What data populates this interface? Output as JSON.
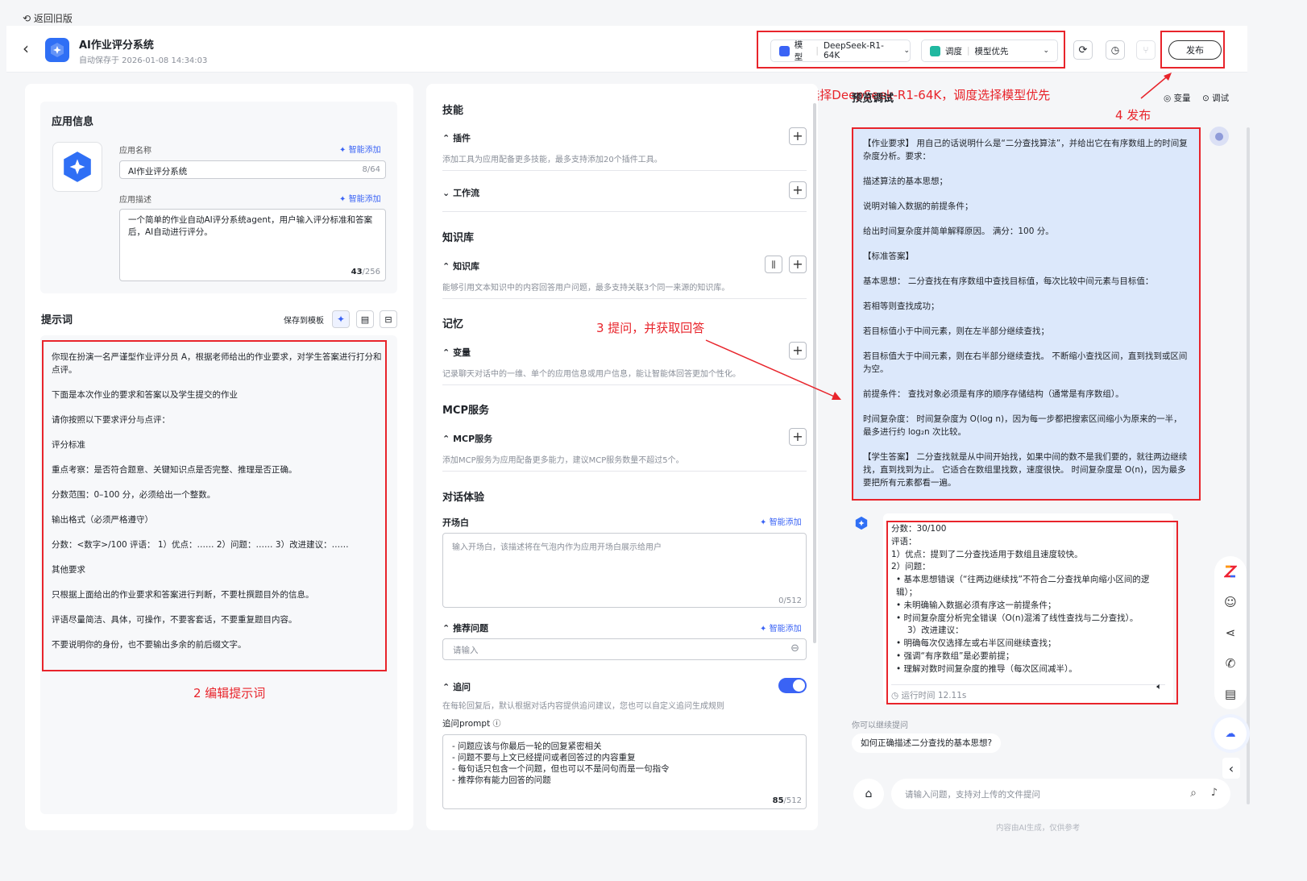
{
  "topbar": {
    "back_old": "返回旧版"
  },
  "header": {
    "app_title": "AI作业评分系统",
    "autosave": "自动保存于 2026-01-08 14:34:03",
    "model_label": "模型",
    "model_value": "DeepSeek-R1-64K",
    "schedule_label": "调度",
    "schedule_value": "模型优先",
    "publish": "发布"
  },
  "annotations": {
    "a1": "1 模型选择DeepSeek-R1-64K，调度选择模型优先",
    "a2": "2 编辑提示词",
    "a3": "3 提问，并获取回答",
    "a4": "4 发布"
  },
  "app_info": {
    "section": "应用信息",
    "name_label": "应用名称",
    "smart_add": "智能添加",
    "name_value": "AI作业评分系统",
    "name_count": "8/64",
    "desc_label": "应用描述",
    "desc_value": "一个简单的作业自动AI评分系统agent，用户输入评分标准和答案后，AI自动进行评分。",
    "desc_count": "43",
    "desc_max": "/256"
  },
  "prompt": {
    "title": "提示词",
    "save_template": "保存到模板",
    "lines": [
      "你现在扮演一名严谨型作业评分员 A，根据老师给出的作业要求，对学生答案进行打分和点评。",
      "下面是本次作业的要求和答案以及学生提交的作业",
      "请你按照以下要求评分与点评：",
      "评分标准",
      "重点考察：是否符合题意、关键知识点是否完整、推理是否正确。",
      "分数范围：0–100 分，必须给出一个整数。",
      "输出格式（必须严格遵守）",
      "分数：<数字>/100 评语： 1）优点：…… 2）问题：…… 3）改进建议：……",
      "其他要求",
      "只根据上面给出的作业要求和答案进行判断，不要杜撰题目外的信息。",
      "评语尽量简洁、具体，可操作，不要客套话，不要重复题目内容。",
      "不要说明你的身份，也不要输出多余的前后缀文字。"
    ]
  },
  "skills": {
    "title": "技能",
    "plugin": "插件",
    "plugin_desc": "添加工具为应用配备更多技能，最多支持添加20个插件工具。",
    "workflow": "工作流",
    "kb_title": "知识库",
    "kb": "知识库",
    "kb_desc": "能够引用文本知识中的内容回答用户问题，最多支持关联3个同一来源的知识库。",
    "memory_title": "记忆",
    "var": "变量",
    "var_desc": "记录聊天对话中的一维、单个的应用信息或用户信息，能让智能体回答更加个性化。",
    "mcp_title": "MCP服务",
    "mcp": "MCP服务",
    "mcp_desc": "添加MCP服务为应用配备更多能力，建议MCP服务数量不超过5个。",
    "dialog_title": "对话体验",
    "opening": "开场白",
    "smart_add": "智能添加",
    "opening_placeholder": "输入开场白，该描述将在气泡内作为应用开场白展示给用户",
    "opening_count": "0/512",
    "recommend": "推荐问题",
    "recommend_placeholder": "请输入",
    "followup": "追问",
    "followup_desc": "在每轮回复后，默认根据对话内容提供追问建议，您也可以自定义追问生成规则",
    "followup_prompt": "追问prompt",
    "followup_lines": [
      "- 问题应该与你最后一轮的回复紧密相关",
      "- 问题不要与上文已经提问或者回答过的内容重复",
      "- 每句话只包含一个问题，但也可以不是问句而是一句指令",
      "- 推荐你有能力回答的问题"
    ],
    "followup_count": "85",
    "followup_max": "/512"
  },
  "preview": {
    "title": "预览调试",
    "var_btn": "变量",
    "debug_btn": "调试",
    "user_msg": [
      "【作业要求】 用自己的话说明什么是“二分查找算法”，并给出它在有序数组上的时间复杂度分析。要求：",
      "描述算法的基本思想；",
      "说明对输入数据的前提条件；",
      "给出时间复杂度并简单解释原因。 满分：100 分。",
      "【标准答案】",
      "基本思想： 二分查找在有序数组中查找目标值，每次比较中间元素与目标值：",
      "若相等则查找成功；",
      "若目标值小于中间元素，则在左半部分继续查找；",
      "若目标值大于中间元素，则在右半部分继续查找。 不断缩小查找区间，直到找到或区间为空。",
      "前提条件： 查找对象必须是有序的顺序存储结构（通常是有序数组）。",
      "时间复杂度： 时间复杂度为 O(log n)，因为每一步都把搜索区间缩小为原来的一半，最多进行约 log₂n 次比较。",
      "【学生答案】 二分查找就是从中间开始找，如果中间的数不是我们要的，就往两边继续找，直到找到为止。 它适合在数组里找数，速度很快。 时间复杂度是 O(n)，因为最多要把所有元素都看一遍。"
    ],
    "answer": {
      "score": "分数：30/100",
      "comment": "评语：",
      "p1": "1）优点：提到了二分查找适用于数组且速度较快。",
      "p2": "2）问题：",
      "issues": [
        "基本思想错误（“往两边继续找”不符合二分查找单向缩小区间的逻辑）；",
        "未明确输入数据必须有序这一前提条件；",
        "时间复杂度分析完全错误（O(n)混淆了线性查找与二分查找）。"
      ],
      "p3": "3）改进建议：",
      "suggestions": [
        "明确每次仅选择左或右半区间继续查找；",
        "强调“有序数组”是必要前提；",
        "理解对数时间复杂度的推导（每次区间减半）。"
      ],
      "runtime": "运行时间 12.11s"
    },
    "continue_label": "你可以继续提问",
    "suggestion": "如何正确描述二分查找的基本思想?",
    "input_placeholder": "请输入问题，支持对上传的文件提问",
    "footer": "内容由AI生成，仅供参考"
  },
  "colors": {
    "accent": "#3a63f5",
    "annotation": "#e8242b",
    "user_bubble": "#dce8fb"
  }
}
